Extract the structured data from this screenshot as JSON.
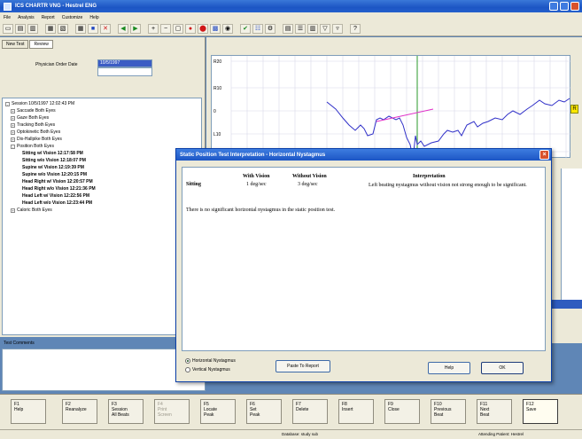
{
  "window": {
    "title": "ICS CHARTR VNG - Hestrel ENG"
  },
  "menu": [
    "File",
    "Analysis",
    "Report",
    "Customize",
    "Help"
  ],
  "left_panel": {
    "tabs": [
      "New Test",
      "Review"
    ],
    "date_label": "Physician Order Date",
    "date_value": "10/5/1997",
    "tree": [
      {
        "label": "Session 10/5/1997 12:02:43 PM",
        "expander": "-",
        "indent": 0,
        "bold": false
      },
      {
        "label": "Saccade Both Eyes",
        "expander": "+",
        "indent": 1,
        "bold": false
      },
      {
        "label": "Gaze Both Eyes",
        "expander": "+",
        "indent": 1,
        "bold": false
      },
      {
        "label": "Tracking Both Eyes",
        "expander": "+",
        "indent": 1,
        "bold": false
      },
      {
        "label": "Optokinetic Both Eyes",
        "expander": "+",
        "indent": 1,
        "bold": false
      },
      {
        "label": "Dix-Hallpike Both Eyes",
        "expander": "+",
        "indent": 1,
        "bold": false
      },
      {
        "label": "Position Both Eyes",
        "expander": "-",
        "indent": 1,
        "bold": false
      },
      {
        "label": "Sitting w/ Vision  12:17:58 PM",
        "expander": "",
        "indent": 2,
        "bold": true
      },
      {
        "label": "Sitting w/o Vision  12:18:07 PM",
        "expander": "",
        "indent": 2,
        "bold": true
      },
      {
        "label": "Supine w/ Vision  12:19:39 PM",
        "expander": "",
        "indent": 2,
        "bold": true
      },
      {
        "label": "Supine w/o Vision  12:20:15 PM",
        "expander": "",
        "indent": 2,
        "bold": true
      },
      {
        "label": "Head Right w/ Vision  12:20:57 PM",
        "expander": "",
        "indent": 2,
        "bold": true
      },
      {
        "label": "Head Right w/o Vision  12:21:36 PM",
        "expander": "",
        "indent": 2,
        "bold": true
      },
      {
        "label": "Head Left w/ Vision  12:22:56 PM",
        "expander": "",
        "indent": 2,
        "bold": true
      },
      {
        "label": "Head Left w/o Vision  12:23:44 PM",
        "expander": "",
        "indent": 2,
        "bold": true
      },
      {
        "label": "Caloric Both Eyes",
        "expander": "+",
        "indent": 1,
        "bold": false
      }
    ],
    "comments_label": "Test Comments"
  },
  "graph": {
    "y_ticks": [
      "R20",
      "R10",
      "0",
      "L10",
      "L20"
    ],
    "marker": "R"
  },
  "dialog": {
    "title": "Static Position Test Interpretation - Horizontal Nystagmus",
    "headers": {
      "with_vision": "With Vision",
      "without_vision": "Without Vision",
      "interpretation": "Interpretation"
    },
    "row": {
      "position": "Sitting",
      "with_vision": "1 deg/sec",
      "without_vision": "3 deg/sec",
      "interpretation": "Left beating nystagmus without vision not strong enough to be significant."
    },
    "summary": "There is no significant horizontal nystagmus in the static position test.",
    "radio_options": [
      {
        "label": "Horizontal Nystagmus",
        "selected": true
      },
      {
        "label": "Vertical Nystagmus",
        "selected": false
      }
    ],
    "paste_button": "Paste To Report",
    "help_button": "Help",
    "ok_button": "OK"
  },
  "function_keys": [
    {
      "key": "F1",
      "label": "Help",
      "dim": false,
      "pressed": false
    },
    {
      "key": "F2",
      "label": "Reanalyze",
      "dim": false,
      "pressed": false
    },
    {
      "key": "F3",
      "label": "Session\nAll Beats",
      "dim": false,
      "pressed": false
    },
    {
      "key": "F4",
      "label": "Print\nScreen",
      "dim": true,
      "pressed": false
    },
    {
      "key": "F5",
      "label": "Locate\nPeak",
      "dim": false,
      "pressed": false
    },
    {
      "key": "F6",
      "label": "Set\nPeak",
      "dim": false,
      "pressed": false
    },
    {
      "key": "F7",
      "label": "Delete",
      "dim": false,
      "pressed": false
    },
    {
      "key": "F8",
      "label": "Insert",
      "dim": false,
      "pressed": false
    },
    {
      "key": "F9",
      "label": "Close",
      "dim": false,
      "pressed": false
    },
    {
      "key": "F10",
      "label": "Previous\nBeat",
      "dim": false,
      "pressed": false
    },
    {
      "key": "F11",
      "label": "Next\nBeat",
      "dim": false,
      "pressed": false
    },
    {
      "key": "F12",
      "label": "Save",
      "dim": false,
      "pressed": true
    }
  ],
  "status": {
    "left": "Database: study sub",
    "right": "Attending Patient: Hestrel"
  },
  "colors": {
    "title_blue": "#1c55c4",
    "trace": "#3030c8",
    "slow_phase": "#e030c8",
    "cursor": "#2a9a2a",
    "background": "#5f86b6"
  }
}
